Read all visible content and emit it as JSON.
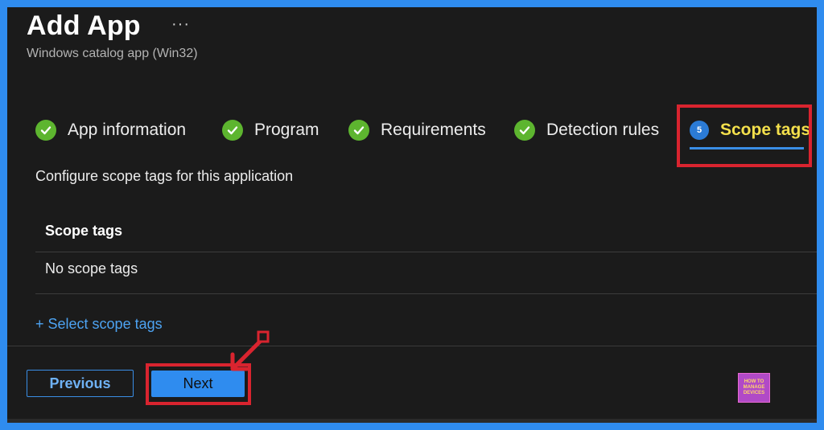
{
  "header": {
    "title": "Add App",
    "more": "···",
    "subtitle": "Windows catalog app (Win32)"
  },
  "steps": [
    {
      "label": "App information",
      "state": "complete"
    },
    {
      "label": "Program",
      "state": "complete"
    },
    {
      "label": "Requirements",
      "state": "complete"
    },
    {
      "label": "Detection rules",
      "state": "complete"
    },
    {
      "label": "Scope tags",
      "state": "active",
      "number": "5"
    }
  ],
  "content": {
    "description": "Configure scope tags for this application",
    "table_header": "Scope tags",
    "empty_row": "No scope tags",
    "select_link": "+ Select scope tags"
  },
  "footer": {
    "previous_label": "Previous",
    "next_label": "Next"
  },
  "logo": {
    "line1": "HOW TO",
    "line2": "MANAGE",
    "line3": "DEVICES"
  },
  "colors": {
    "accent": "#2f8cef",
    "check": "#5db52f",
    "active_step": "#f4e04c",
    "annotation": "#d9242f"
  }
}
